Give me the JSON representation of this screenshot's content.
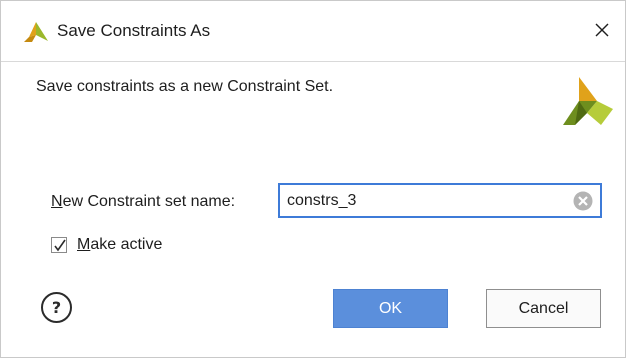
{
  "window": {
    "title": "Save Constraints As",
    "icons": {
      "app": "vivado-logo-icon",
      "close": "close-icon"
    }
  },
  "dialog": {
    "description": "Save constraints as a new Constraint Set.",
    "header_icon": "vivado-logo-icon"
  },
  "form": {
    "name_label_mnemonic": "N",
    "name_label_rest": "ew Constraint set name:",
    "name_value": "constrs_3",
    "clear_icon": "clear-icon",
    "make_active_checked": true,
    "make_active_mnemonic": "M",
    "make_active_rest": "ake active"
  },
  "buttons": {
    "help_label": "?",
    "ok_label": "OK",
    "cancel_label": "Cancel"
  },
  "colors": {
    "accent": "#5b8fdc",
    "input_border": "#3e7bd8",
    "logo_gold": "#e0a21b",
    "logo_green": "#6e8e1e"
  }
}
